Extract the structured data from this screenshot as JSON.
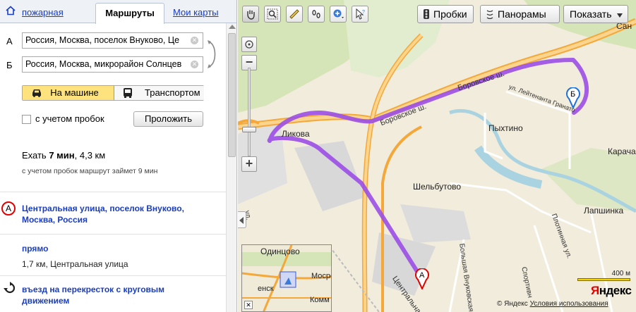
{
  "tabs": {
    "fire": "пожарная",
    "routes": "Маршруты",
    "maps": "Мои карты"
  },
  "route": {
    "label_a": "А",
    "label_b": "Б",
    "from": "Россия, Москва, поселок Внуково, Це",
    "to": "Россия, Москва, микрорайон Солнцев",
    "mode_car": "На машине",
    "mode_transit": "Транспортом",
    "traffic_checkbox": "с учетом пробок",
    "build_button": "Проложить",
    "summary_prefix": "Ехать ",
    "summary_time": "7 мин",
    "summary_suffix": ", 4,3 км",
    "summary_traffic": "с учетом пробок маршрут займет 9 мин",
    "steps": [
      {
        "title": "Центральная улица, поселок Внуково, Москва, Россия",
        "sub": ""
      },
      {
        "title": "прямо",
        "sub": "1,7 км, Центральная улица"
      },
      {
        "title": "въезд на перекресток с круговым движением",
        "sub": ""
      }
    ]
  },
  "map": {
    "toolbar": {
      "traffic": "Пробки",
      "panoramas": "Панорамы",
      "show": "Показать"
    },
    "places": {
      "likova": "Ликова",
      "pykhtino": "Пыхтино",
      "shelbutovo": "Шельбутово",
      "lapshinka": "Лапшинка",
      "karacha": "Карача",
      "san": "Сан"
    },
    "streets": {
      "borovskoe1": "Боровское ш.",
      "borovskoe2": "Боровское ш.",
      "leytenanta": "ул. Лейтенанта Гранато",
      "tsentralnaya": "Центральна",
      "bolshaya_vnukovskaya": "Большая Внуковская",
      "plotinnaya": "Плотинная ул.",
      "sportivnaya": "Спортивн",
      "u": "ул."
    },
    "pin_a": "А",
    "pin_b": "Б",
    "minimap": {
      "odintsovo": "Одинцово",
      "mosr": "Мосро",
      "ensk": "енск",
      "komm": "Комм"
    },
    "scale": "400 м",
    "logo_red": "Я",
    "logo_rest": "ндекс",
    "copyright": "© Яндекс",
    "terms": "Условия использования",
    "colors": {
      "route": "#9b4ee6",
      "highway": "#f4a83a",
      "water": "#a9d3e0",
      "pin_a": "#e10000",
      "pin_b": "#1e6fd9"
    }
  }
}
